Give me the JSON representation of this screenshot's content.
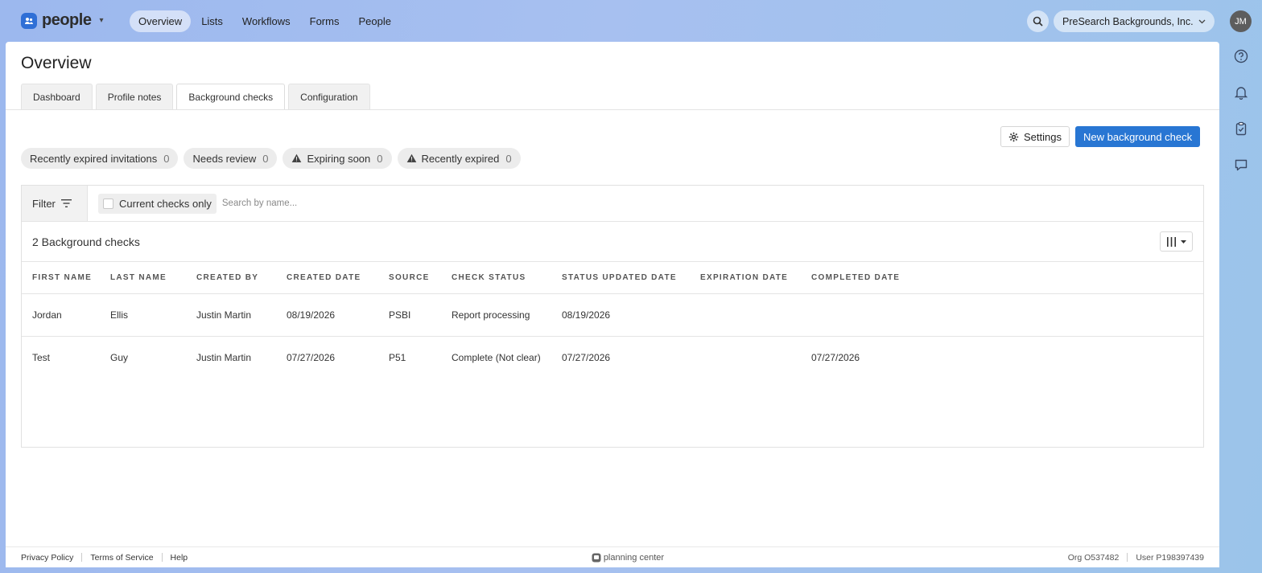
{
  "topbar": {
    "app_name": "people",
    "nav": [
      "Overview",
      "Lists",
      "Workflows",
      "Forms",
      "People"
    ],
    "active_nav": "Overview",
    "org_name": "PreSearch Backgrounds, Inc.",
    "avatar_initials": "JM"
  },
  "page": {
    "title": "Overview",
    "tabs": [
      "Dashboard",
      "Profile notes",
      "Background checks",
      "Configuration"
    ],
    "active_tab": "Background checks"
  },
  "actions": {
    "settings_label": "Settings",
    "new_label": "New background check"
  },
  "chips": [
    {
      "label": "Recently expired invitations",
      "count": "0",
      "icon": ""
    },
    {
      "label": "Needs review",
      "count": "0",
      "icon": ""
    },
    {
      "label": "Expiring soon",
      "count": "0",
      "icon": "warning-icon"
    },
    {
      "label": "Recently expired",
      "count": "0",
      "icon": "warning-icon"
    }
  ],
  "filter": {
    "label": "Filter",
    "current_only_label": "Current checks only",
    "search_placeholder": "Search by name...",
    "search_value": ""
  },
  "table": {
    "count_label": "2 Background checks",
    "columns": [
      "FIRST NAME",
      "LAST NAME",
      "CREATED BY",
      "CREATED DATE",
      "SOURCE",
      "CHECK STATUS",
      "STATUS UPDATED DATE",
      "EXPIRATION DATE",
      "COMPLETED DATE"
    ],
    "rows": [
      [
        "Jordan",
        "Ellis",
        "Justin Martin",
        "08/19/2026",
        "PSBI",
        "Report processing",
        "08/19/2026",
        "",
        ""
      ],
      [
        "Test",
        "Guy",
        "Justin Martin",
        "07/27/2026",
        "P51",
        "Complete (Not clear)",
        "07/27/2026",
        "",
        "07/27/2026"
      ]
    ]
  },
  "footer": {
    "links": [
      "Privacy Policy",
      "Terms of Service",
      "Help"
    ],
    "brand": "planning center",
    "org_id": "Org O537482",
    "user_id": "User P198397439"
  },
  "colors": {
    "primary": "#2876d3",
    "logo": "#2f6fd6",
    "background_gradient": "#a7c0f0"
  }
}
